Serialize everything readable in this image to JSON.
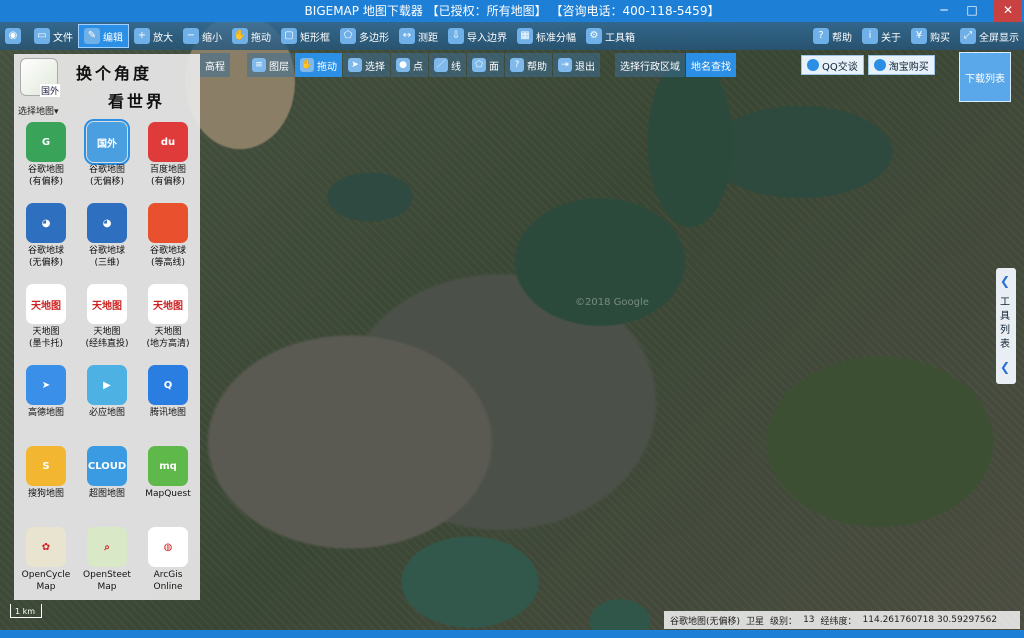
{
  "window": {
    "title": "BIGEMAP 地图下载器 【已授权：所有地图】 【咨询电话：400-118-5459】",
    "controls": {
      "minimize": "─",
      "maximize": "□",
      "close": "✕"
    }
  },
  "toolbar1": {
    "items": [
      {
        "label": "",
        "icon": "app-logo-icon",
        "glyph": "◉"
      },
      {
        "label": "文件",
        "icon": "file-icon",
        "glyph": "▭"
      },
      {
        "label": "编辑",
        "icon": "edit-icon",
        "glyph": "✎",
        "active": true
      },
      {
        "label": "放大",
        "icon": "zoom-in-icon",
        "glyph": "+"
      },
      {
        "label": "缩小",
        "icon": "zoom-out-icon",
        "glyph": "−"
      },
      {
        "label": "拖动",
        "icon": "hand-icon",
        "glyph": "✋"
      },
      {
        "label": "矩形框",
        "icon": "rectangle-icon",
        "glyph": "▢"
      },
      {
        "label": "多边形",
        "icon": "polygon-icon",
        "glyph": "⬠"
      },
      {
        "label": "测距",
        "icon": "ruler-icon",
        "glyph": "↔"
      },
      {
        "label": "导入边界",
        "icon": "import-boundary-icon",
        "glyph": "⇩"
      },
      {
        "label": "标准分幅",
        "icon": "grid-icon",
        "glyph": "▦"
      },
      {
        "label": "工具箱",
        "icon": "toolbox-icon",
        "glyph": "⚙"
      },
      {
        "label": "帮助",
        "icon": "help-icon",
        "glyph": "?"
      },
      {
        "label": "关于",
        "icon": "info-icon",
        "glyph": "i"
      },
      {
        "label": "购买",
        "icon": "cart-icon",
        "glyph": "¥"
      },
      {
        "label": "全屏显示",
        "icon": "fullscreen-icon",
        "glyph": "⤢"
      }
    ]
  },
  "toolbar2": {
    "items": [
      {
        "label": "高程",
        "icon": "",
        "glyph": ""
      },
      {
        "label": "图层",
        "icon": "layers-icon",
        "glyph": "≡"
      },
      {
        "label": "拖动",
        "icon": "hand-icon",
        "glyph": "✋",
        "active": true
      },
      {
        "label": "选择",
        "icon": "select-arrow-icon",
        "glyph": "➤"
      },
      {
        "label": "点",
        "icon": "pin-icon",
        "glyph": "●"
      },
      {
        "label": "线",
        "icon": "line-icon",
        "glyph": "／"
      },
      {
        "label": "面",
        "icon": "polygon-icon",
        "glyph": "⬠"
      },
      {
        "label": "帮助",
        "icon": "help-icon",
        "glyph": "?"
      },
      {
        "label": "退出",
        "icon": "exit-icon",
        "glyph": "⇥"
      }
    ],
    "region_tabs": [
      {
        "label": "选择行政区域"
      },
      {
        "label": "地名查找",
        "active": true
      }
    ],
    "qq": "QQ交谈",
    "taobao": "淘宝购买",
    "download_list": "下载列表"
  },
  "left_panel": {
    "current_map_label": "国外",
    "select_map": "选择地图▾",
    "slogan_line1": "换个角度",
    "slogan_line2": "看世界",
    "maps": [
      {
        "label": "谷歌地图\n(有偏移)",
        "icon": "google-maps-icon",
        "text": "G",
        "color": "#3aa35a"
      },
      {
        "label": "谷歌地图\n(无偏移)",
        "icon": "google-maps-foreign-icon",
        "text": "国外",
        "color": "#4a9fe0",
        "selected": true
      },
      {
        "label": "百度地图\n(有偏移)",
        "icon": "baidu-map-icon",
        "text": "du",
        "color": "#e03b3b"
      },
      {
        "label": "谷歌地球\n(无偏移)",
        "icon": "google-earth-icon",
        "text": "◕",
        "color": "#2f6fbf"
      },
      {
        "label": "谷歌地球\n(三维)",
        "icon": "google-earth-3d-icon",
        "text": "◕",
        "color": "#2f6fbf"
      },
      {
        "label": "谷歌地球\n(等高线)",
        "icon": "google-earth-contour-icon",
        "text": "",
        "color": "#e8502e"
      },
      {
        "label": "天地图\n(墨卡托)",
        "icon": "tianditu-icon",
        "text": "天地图",
        "color": "#ffffff"
      },
      {
        "label": "天地图\n(经纬直投)",
        "icon": "tianditu-icon",
        "text": "天地图",
        "color": "#ffffff"
      },
      {
        "label": "天地图\n(地方高清)",
        "icon": "tianditu-icon",
        "text": "天地图",
        "color": "#ffffff"
      },
      {
        "label": "高德地图",
        "icon": "gaode-map-icon",
        "text": "➤",
        "color": "#3a8fe8"
      },
      {
        "label": "必应地图",
        "icon": "bing-map-icon",
        "text": "▶",
        "color": "#4db2e3"
      },
      {
        "label": "腾讯地图",
        "icon": "tencent-map-icon",
        "text": "Q",
        "color": "#2a7de1"
      },
      {
        "label": "搜狗地图",
        "icon": "sogou-map-icon",
        "text": "S",
        "color": "#f2b630"
      },
      {
        "label": "超图地图",
        "icon": "supermap-icon",
        "text": "CLOUD",
        "color": "#3a9be3"
      },
      {
        "label": "MapQuest",
        "icon": "mapquest-icon",
        "text": "mq",
        "color": "#5fb84a"
      },
      {
        "label": "OpenCycle\nMap",
        "icon": "opencyclemap-icon",
        "text": "✿",
        "color": "#e9e4cf"
      },
      {
        "label": "OpenSteet\nMap",
        "icon": "openstreetmap-icon",
        "text": "⌕",
        "color": "#d9e8c6"
      },
      {
        "label": "ArcGis\nOnline",
        "icon": "arcgis-icon",
        "text": "◍",
        "color": "#ffffff"
      }
    ]
  },
  "tool_tab": {
    "label": "工具列表",
    "arrow": "❮"
  },
  "map": {
    "watermark": "©2018 Google"
  },
  "status": {
    "map_name": "谷歌地图(无偏移)",
    "layer": "卫星",
    "level_label": "级别：",
    "level": "13",
    "coord_label": "经纬度：",
    "coords": "114.261760718  30.59297562"
  },
  "scale": {
    "label": "1 km"
  }
}
